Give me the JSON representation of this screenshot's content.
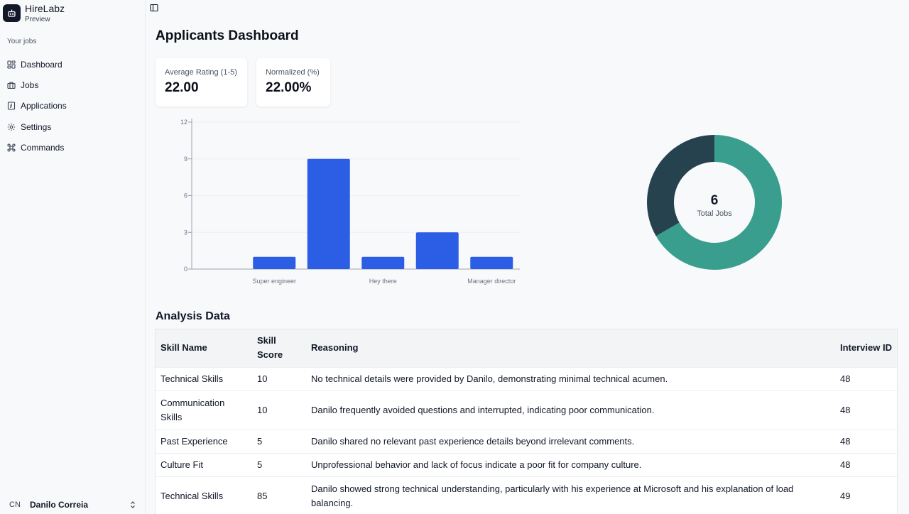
{
  "app": {
    "name": "HireLabz",
    "subtitle": "Preview"
  },
  "sidebar": {
    "section_label": "Your jobs",
    "items": [
      {
        "label": "Dashboard",
        "icon": "dashboard-icon"
      },
      {
        "label": "Jobs",
        "icon": "briefcase-icon"
      },
      {
        "label": "Applications",
        "icon": "document-icon"
      },
      {
        "label": "Settings",
        "icon": "gear-icon"
      },
      {
        "label": "Commands",
        "icon": "command-icon"
      }
    ],
    "user": {
      "initials": "CN",
      "name": "Danilo Correia"
    }
  },
  "page": {
    "title": "Applicants Dashboard"
  },
  "stats": [
    {
      "label": "Average Rating (1-5)",
      "value": "22.00"
    },
    {
      "label": "Normalized (%)",
      "value": "22.00%"
    }
  ],
  "chart_data": [
    {
      "type": "bar",
      "categories": [
        "Super engineer",
        "",
        "Hey there",
        "",
        "Manager director"
      ],
      "values": [
        1,
        9,
        1,
        3,
        1
      ],
      "ylim": [
        0,
        12
      ],
      "yticks": [
        0,
        3,
        6,
        9,
        12
      ],
      "grid": true,
      "colors": {
        "bar": "#2b5ee5"
      }
    },
    {
      "type": "pie",
      "values": [
        4,
        2
      ],
      "center_value": "6",
      "center_label": "Total Jobs",
      "colors": [
        "#3a9e8f",
        "#26424f"
      ]
    }
  ],
  "analysis": {
    "title": "Analysis Data",
    "columns": [
      "Skill Name",
      "Skill Score",
      "Reasoning",
      "Interview ID"
    ],
    "rows": [
      [
        "Technical Skills",
        "10",
        "No technical details were provided by Danilo, demonstrating minimal technical acumen.",
        "48"
      ],
      [
        "Communication Skills",
        "10",
        "Danilo frequently avoided questions and interrupted, indicating poor communication.",
        "48"
      ],
      [
        "Past Experience",
        "5",
        "Danilo shared no relevant past experience details beyond irrelevant comments.",
        "48"
      ],
      [
        "Culture Fit",
        "5",
        "Unprofessional behavior and lack of focus indicate a poor fit for company culture.",
        "48"
      ],
      [
        "Technical Skills",
        "85",
        "Danilo showed strong technical understanding, particularly with his experience at Microsoft and his explanation of load balancing.",
        "49"
      ]
    ]
  }
}
